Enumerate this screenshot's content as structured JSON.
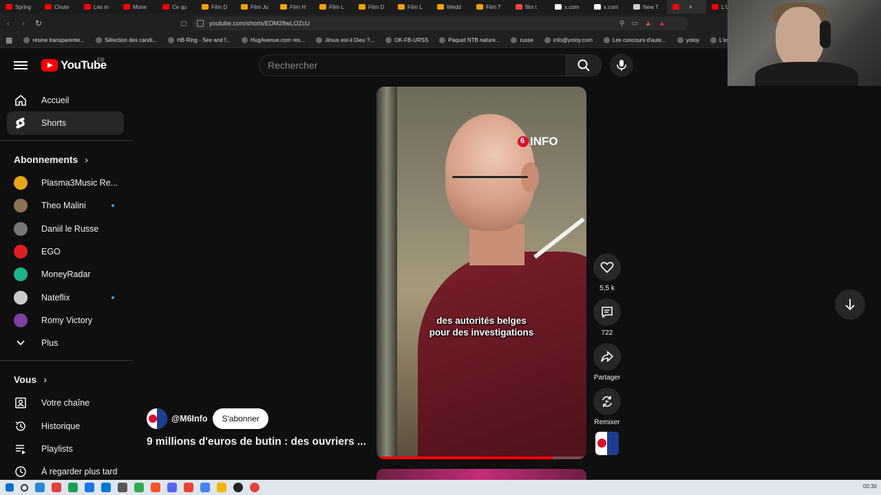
{
  "browser": {
    "tabs": [
      {
        "label": "Spring",
        "color": "#ff0000"
      },
      {
        "label": "Chute",
        "color": "#ff0000"
      },
      {
        "label": "Les m",
        "color": "#ff0000"
      },
      {
        "label": "Mone",
        "color": "#ff0000"
      },
      {
        "label": "Ce qu",
        "color": "#ff0000"
      },
      {
        "label": "Film D",
        "color": "#f7a000"
      },
      {
        "label": "Film Ju",
        "color": "#f7a000"
      },
      {
        "label": "Film H",
        "color": "#f7a000"
      },
      {
        "label": "Film L",
        "color": "#f7a000"
      },
      {
        "label": "Film D",
        "color": "#f7a000"
      },
      {
        "label": "Film L",
        "color": "#f7a000"
      },
      {
        "label": "Wedd",
        "color": "#f7a000"
      },
      {
        "label": "Film T",
        "color": "#f7a000"
      },
      {
        "label": "film t",
        "color": "#ff4444"
      },
      {
        "label": "x.com",
        "color": "#ffffff"
      },
      {
        "label": "x.com",
        "color": "#ffffff"
      },
      {
        "label": "New T",
        "color": "#cccccc"
      },
      {
        "label": "",
        "color": "#ff0000",
        "active": true
      },
      {
        "label": "L'IA v",
        "color": "#ff0000"
      }
    ],
    "url": "youtube.com/shorts/EDM28wLOZcU",
    "bookmarks": [
      "résine transparente...",
      "Sélection des candi...",
      "HB Ring - See and f...",
      "HugAvenue.com res...",
      "Jésus est-il Dieu ?...",
      "OK-FB-URSS",
      "Paquet NTB nature...",
      "russe",
      "info@yotoy.com",
      "Les concours d'aute...",
      "yotoy",
      "L'esquif fa"
    ]
  },
  "header": {
    "logo_text": "YouTube",
    "region": "FR",
    "search_placeholder": "Rechercher"
  },
  "sidebar": {
    "main": [
      {
        "label": "Accueil",
        "icon": "home-icon"
      },
      {
        "label": "Shorts",
        "icon": "shorts-icon",
        "active": true
      }
    ],
    "subscriptions_heading": "Abonnements",
    "subscriptions": [
      {
        "label": "Plasma3Music Re...",
        "color": "#e8a317",
        "dot": false
      },
      {
        "label": "Theo Malini",
        "color": "#8b7355",
        "dot": true
      },
      {
        "label": "Daniil le Russe",
        "color": "#777777",
        "dot": false
      },
      {
        "label": "EGO",
        "color": "#e02020",
        "dot": false
      },
      {
        "label": "MoneyRadar",
        "color": "#1db38a",
        "dot": false
      },
      {
        "label": "Nateflix",
        "color": "#cccccc",
        "dot": true
      },
      {
        "label": "Romy Victory",
        "color": "#7a3fa0",
        "dot": false
      }
    ],
    "more_label": "Plus",
    "you_heading": "Vous",
    "you_items": [
      {
        "label": "Votre chaîne",
        "icon": "channel-icon"
      },
      {
        "label": "Historique",
        "icon": "history-icon"
      },
      {
        "label": "Playlists",
        "icon": "playlists-icon"
      },
      {
        "label": "À regarder plus tard",
        "icon": "watch-later-icon"
      }
    ]
  },
  "short": {
    "overlay_logo": "INFO",
    "subtitle_line1": "des autorités belges",
    "subtitle_line2": "pour des investigations",
    "progress": 0.84,
    "channel_handle": "@M6Info",
    "subscribe_label": "S'abonner",
    "title": "9 millions d'euros de butin : des ouvriers ..."
  },
  "actions": {
    "likes": "5,5 k",
    "comments": "722",
    "share_label": "Partager",
    "remix_label": "Remixer"
  },
  "taskbar": {
    "time": "00:30"
  }
}
